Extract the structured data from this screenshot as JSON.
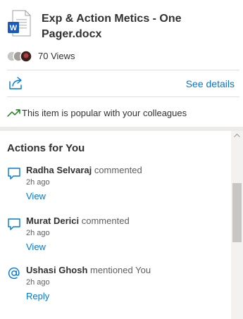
{
  "file": {
    "title": "Exp & Action Metics - One Pager.docx",
    "icon": "word-doc-icon",
    "views": "70 Views"
  },
  "toolbar": {
    "share_icon": "share-icon",
    "see_details": "See details"
  },
  "popular": {
    "icon": "trending-up-icon",
    "text": "This item is popular with your colleagues"
  },
  "actions": {
    "title": "Actions for You",
    "items": [
      {
        "icon": "comment-icon",
        "who": "Radha Selvaraj",
        "what": " commented",
        "time": "2h ago",
        "link": "View"
      },
      {
        "icon": "comment-icon",
        "who": "Murat Derici",
        "what": " commented",
        "time": "2h ago",
        "link": "View"
      },
      {
        "icon": "mention-icon",
        "who": "Ushasi Ghosh",
        "what": " mentioned You",
        "time": "2h ago",
        "link": "Reply"
      }
    ]
  },
  "colors": {
    "link": "#0078d4",
    "word_blue": "#185abd",
    "trend_green": "#107c10",
    "divider": "#e1dfdd"
  }
}
